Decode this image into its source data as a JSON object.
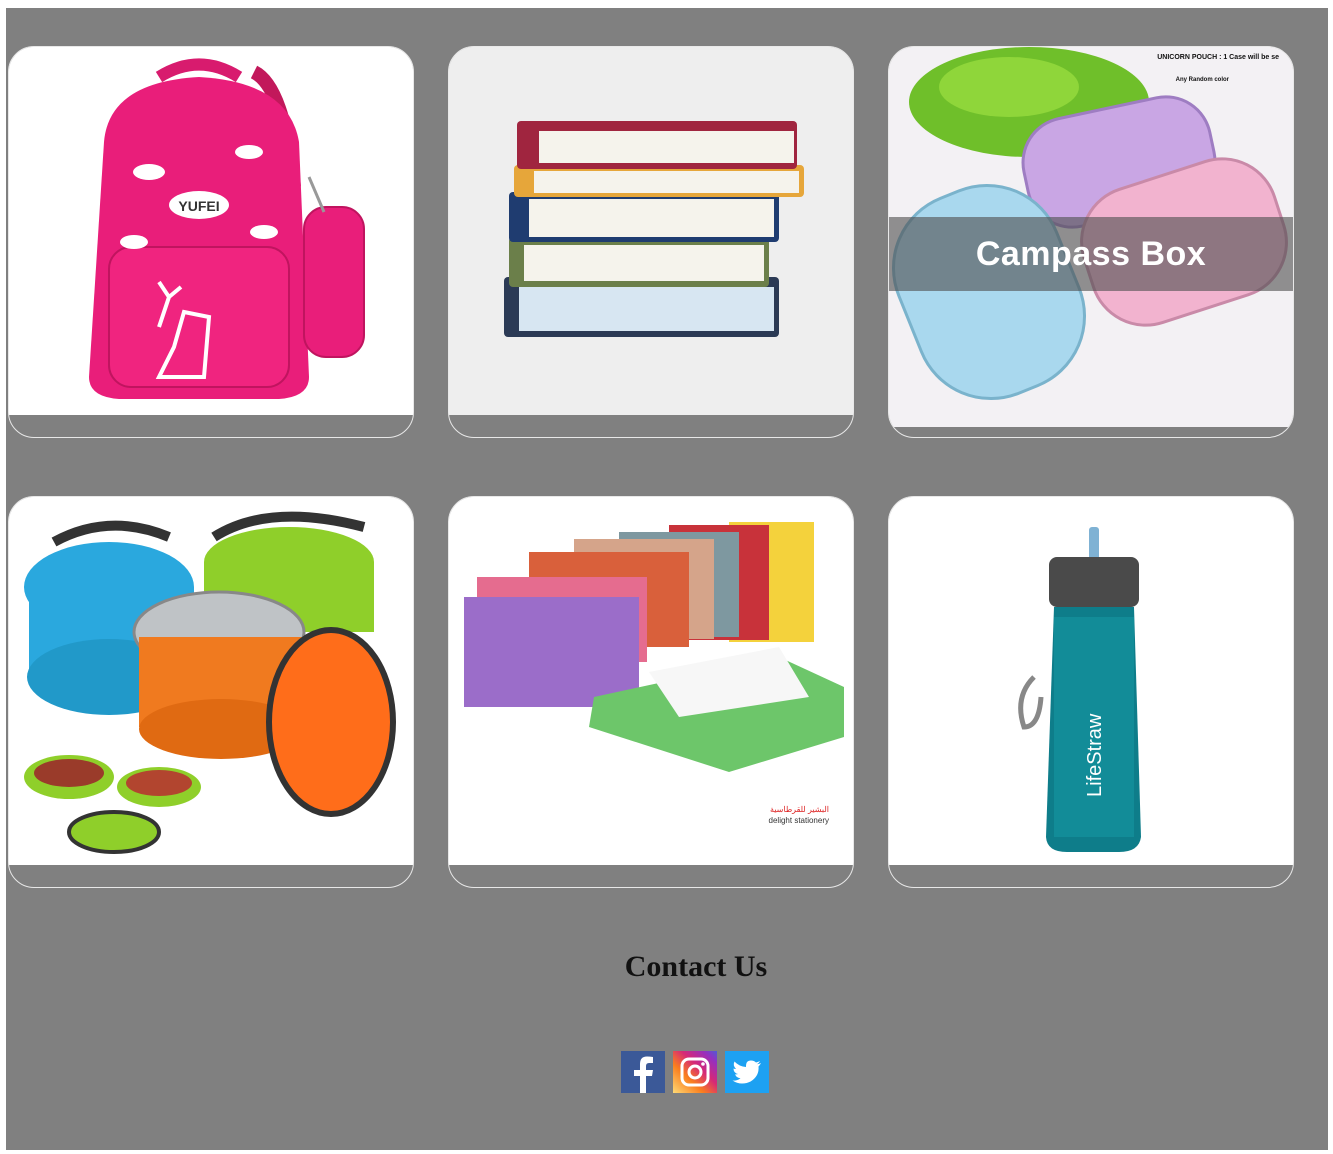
{
  "products": [
    {
      "name": "backpack",
      "caption": ""
    },
    {
      "name": "books",
      "caption": ""
    },
    {
      "name": "pencil-case",
      "caption": "Campass Box",
      "image_text": [
        "UNICORN POUCH : 1 Case will be se",
        "Any Random color"
      ]
    },
    {
      "name": "lunch-box",
      "caption": ""
    },
    {
      "name": "folders",
      "caption": "",
      "image_text": [
        "البشير للقرطاسية",
        "delight stationery"
      ]
    },
    {
      "name": "water-bottle",
      "caption": "",
      "image_text": [
        "LifeStraw"
      ]
    }
  ],
  "backpack_brand": "YUFEI",
  "contact": {
    "title": "Contact Us"
  },
  "social": [
    {
      "name": "facebook-icon",
      "color": "#3b5998"
    },
    {
      "name": "instagram-icon",
      "color": "#e1306c"
    },
    {
      "name": "twitter-icon",
      "color": "#1da1f2"
    }
  ],
  "colors": {
    "background": "#808080",
    "card_border": "#e8e8e8"
  }
}
